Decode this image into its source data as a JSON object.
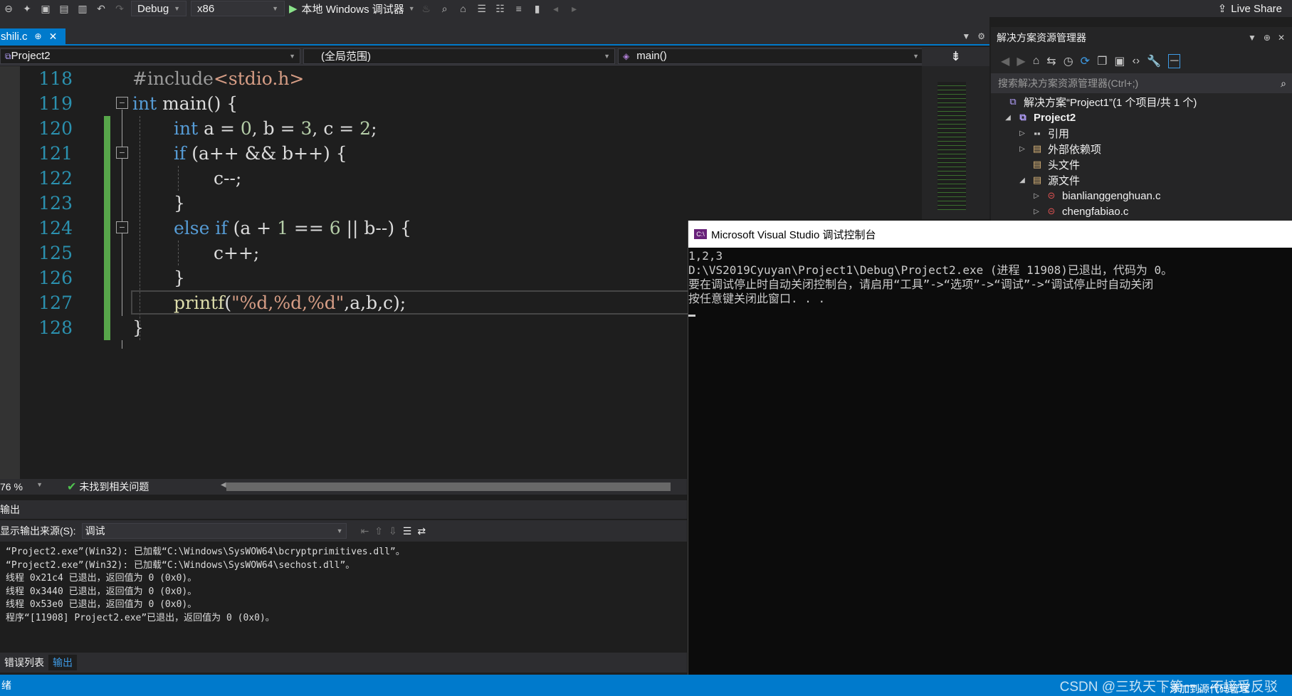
{
  "toolbar": {
    "config": "Debug",
    "platform": "x86",
    "run_label": "本地 Windows 调试器",
    "live_share": "Live Share"
  },
  "tab": {
    "file": "shili.c"
  },
  "nav": {
    "project": "Project2",
    "scope": "(全局范围)",
    "member": "main()"
  },
  "editor": {
    "lines": [
      {
        "num": "118"
      },
      {
        "num": "119"
      },
      {
        "num": "120"
      },
      {
        "num": "121"
      },
      {
        "num": "122"
      },
      {
        "num": "123"
      },
      {
        "num": "124"
      },
      {
        "num": "125"
      },
      {
        "num": "126"
      },
      {
        "num": "127"
      },
      {
        "num": "128"
      }
    ],
    "code": {
      "l118_pp": "#include",
      "l118_inc": "<stdio.h>",
      "l119_kw": "int",
      "l119_rest": " main() {",
      "l120_kw": "int",
      "l120_a": " a = ",
      "l120_n0": "0",
      "l120_b": ", b = ",
      "l120_n3": "3",
      "l120_c": ", c = ",
      "l120_n2": "2",
      "l120_end": ";",
      "l121_kw": "if",
      "l121_rest": " (a++ && b++) {",
      "l122": "c--;",
      "l123": "}",
      "l124_kw1": "else",
      "l124_kw2": "if",
      "l124_a": " (a + ",
      "l124_n1": "1",
      "l124_b": " == ",
      "l124_n6": "6",
      "l124_c": " || b--) {",
      "l125": "c++;",
      "l126": "}",
      "l127_fn": "printf",
      "l127_open": "(",
      "l127_str": "\"%d,%d,%d\"",
      "l127_rest": ",a,b,c);",
      "l128": "}"
    },
    "zoom": "76 %",
    "issues": "未找到相关问题"
  },
  "output": {
    "title": "输出",
    "source_label": "显示输出来源(S):",
    "source_value": "调试",
    "lines": "“Project2.exe”(Win32): 已加载“C:\\Windows\\SysWOW64\\bcryptprimitives.dll”。\n“Project2.exe”(Win32): 已加载“C:\\Windows\\SysWOW64\\sechost.dll”。\n线程 0x21c4 已退出，返回值为 0 (0x0)。\n线程 0x3440 已退出，返回值为 0 (0x0)。\n线程 0x53e0 已退出，返回值为 0 (0x0)。\n程序“[11908] Project2.exe”已退出，返回值为 0 (0x0)。"
  },
  "bottom_tabs": {
    "errors": "错误列表",
    "output": "输出"
  },
  "solution_explorer": {
    "title": "解决方案资源管理器",
    "search_placeholder": "搜索解决方案资源管理器(Ctrl+;)",
    "items": [
      {
        "label": "解决方案“Project1”(1 个项目/共 1 个)"
      },
      {
        "label": "Project2"
      },
      {
        "label": "引用"
      },
      {
        "label": "外部依赖项"
      },
      {
        "label": "头文件"
      },
      {
        "label": "源文件"
      },
      {
        "label": "bianlianggenghuan.c"
      },
      {
        "label": "chengfabiao.c"
      }
    ]
  },
  "console": {
    "title": "Microsoft Visual Studio 调试控制台",
    "icon_text": "C:\\",
    "output": "1,2,3\nD:\\VS2019Cyuyan\\Project1\\Debug\\Project2.exe (进程 11908)已退出，代码为 0。\n要在调试停止时自动关闭控制台，请启用“工具”->“选项”->“调试”->“调试停止时自动关闭\n按任意键关闭此窗口. . ."
  },
  "statusbar": {
    "left": "绪",
    "right": "添加到源代码管理",
    "watermark": "CSDN @三玖天下第一，不接受反驳"
  },
  "colors": {
    "accent": "#007acc",
    "editor_bg": "#1e1e1e",
    "keyword": "#569cd6",
    "string": "#d69d85",
    "number": "#b5cea8",
    "line_number": "#2b91af",
    "change_bar": "#57a64a"
  }
}
